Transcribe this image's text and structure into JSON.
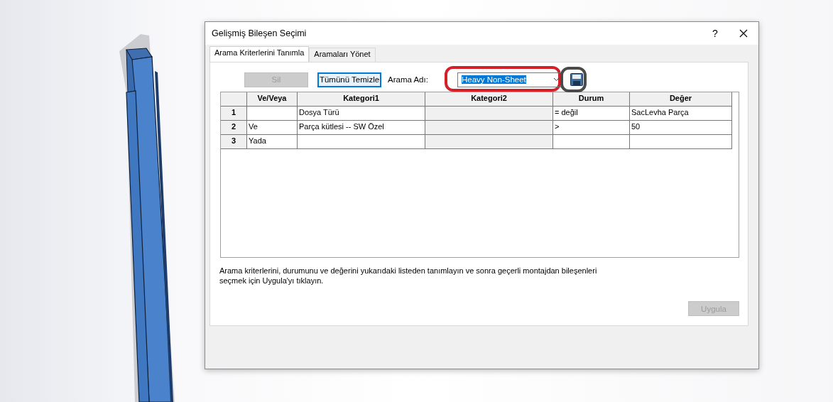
{
  "window": {
    "title": "Gelişmiş Bileşen Seçimi",
    "help": "?"
  },
  "tabs": [
    {
      "label": "Arama Kriterlerini Tanımla",
      "selected": true
    },
    {
      "label": "Aramaları Yönet",
      "selected": false
    }
  ],
  "toolbar": {
    "buttons": [
      {
        "label": "Sil",
        "disabled": true,
        "focused": false
      },
      {
        "label": "Tümünü Temizle",
        "disabled": false,
        "focused": true
      }
    ],
    "search_name": {
      "label": "Arama Adı:",
      "value": "Heavy Non-Sheet",
      "text_selected": true
    }
  },
  "table": {
    "columns": [
      {
        "label": "Ve/Veya",
        "disabled": false
      },
      {
        "label": "Kategori1",
        "disabled": false
      },
      {
        "label": "Kategori2",
        "disabled": true
      },
      {
        "label": "Durum",
        "disabled": false
      },
      {
        "label": "Değer",
        "disabled": false
      }
    ],
    "rows": [
      {
        "number": "1",
        "cells": [
          null,
          "Dosya Türü",
          null,
          "= değil",
          "SacLevha Parça"
        ]
      },
      {
        "number": "2",
        "cells": [
          "Ve",
          "Parça kütlesi -- SW Özel",
          null,
          ">",
          "50"
        ]
      },
      {
        "number": "3",
        "cells": [
          "Yada",
          null,
          null,
          null,
          null
        ]
      }
    ]
  },
  "hint": "Arama kriterlerini, durumunu ve değerini yukarıdaki listeden tanımlayın ve sonra geçerli montajdan bileşenleri seçmek için Uygula'yı tıklayın.",
  "apply_button": {
    "label": "Uygula",
    "disabled": true
  }
}
